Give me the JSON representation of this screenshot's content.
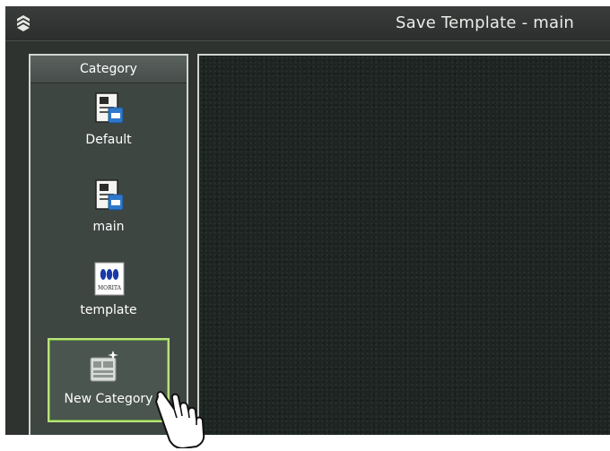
{
  "window": {
    "title": "Save Template - main"
  },
  "sidebar": {
    "header": "Category",
    "items": [
      {
        "label": "Default",
        "icon": "document-id-icon"
      },
      {
        "label": "main",
        "icon": "document-id-icon"
      },
      {
        "label": "template",
        "icon": "morita-logo-icon",
        "logo_text": "MORITA"
      }
    ],
    "new_category": {
      "label": "New Category",
      "icon": "new-category-icon"
    }
  },
  "colors": {
    "window_bg": "#2f3330",
    "sidebar_bg": "#3e4642",
    "content_bg": "#1d2522",
    "highlight": "#b9e27a"
  }
}
